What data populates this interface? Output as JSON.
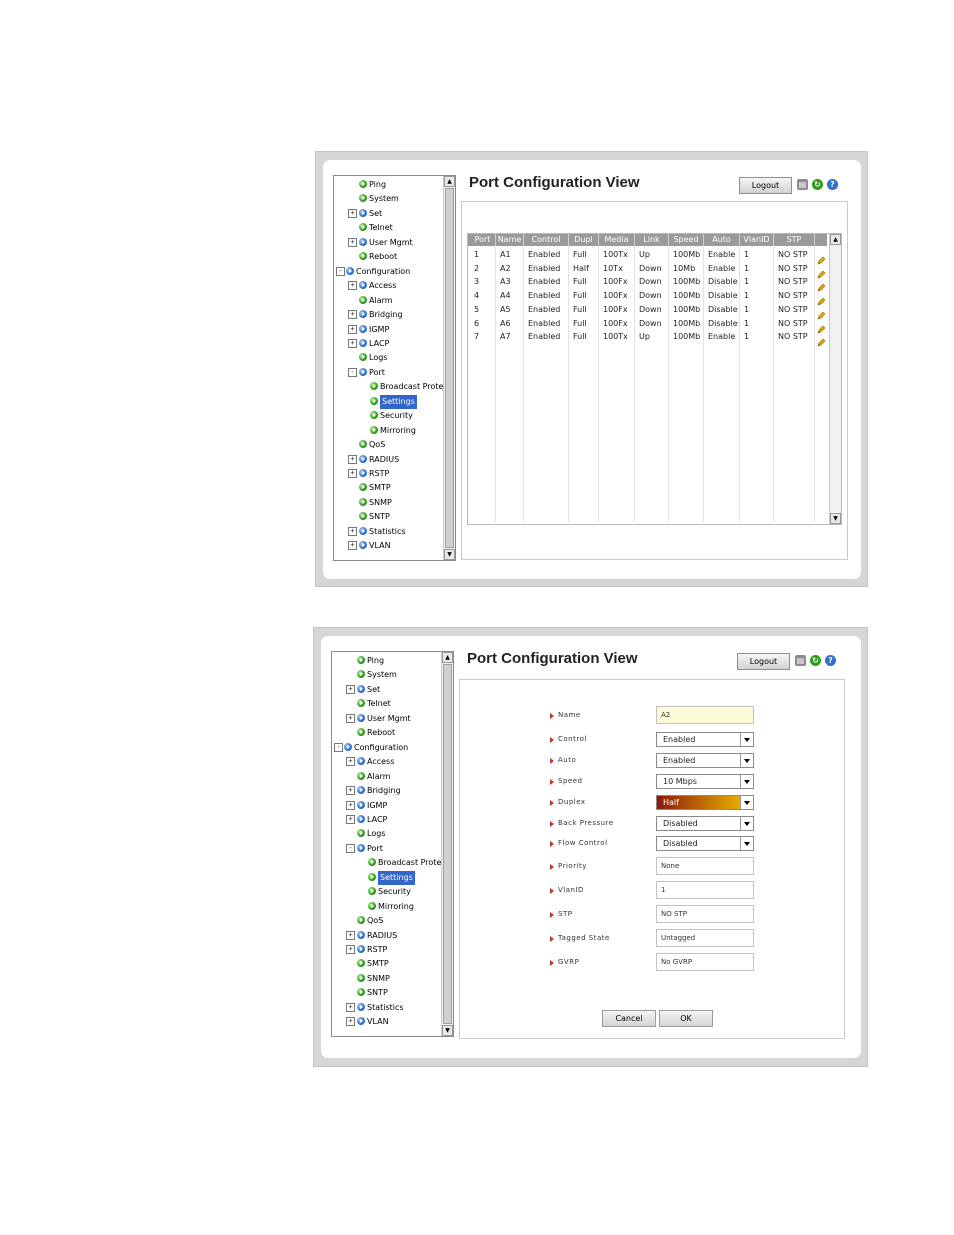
{
  "nav_tree": [
    {
      "label": "Ping",
      "bullet": "green",
      "expander": "",
      "level": 1
    },
    {
      "label": "System",
      "bullet": "green",
      "expander": "",
      "level": 1
    },
    {
      "label": "Set",
      "bullet": "blue",
      "expander": "+",
      "level": 1
    },
    {
      "label": "Telnet",
      "bullet": "green",
      "expander": "",
      "level": 1
    },
    {
      "label": "User Mgmt",
      "bullet": "blue",
      "expander": "+",
      "level": 1
    },
    {
      "label": "Reboot",
      "bullet": "green",
      "expander": "",
      "level": 1
    },
    {
      "label": "Configuration",
      "bullet": "blue",
      "expander": "-",
      "level": 0
    },
    {
      "label": "Access",
      "bullet": "blue",
      "expander": "+",
      "level": 1
    },
    {
      "label": "Alarm",
      "bullet": "green",
      "expander": "",
      "level": 1
    },
    {
      "label": "Bridging",
      "bullet": "blue",
      "expander": "+",
      "level": 1
    },
    {
      "label": "IGMP",
      "bullet": "blue",
      "expander": "+",
      "level": 1
    },
    {
      "label": "LACP",
      "bullet": "blue",
      "expander": "+",
      "level": 1
    },
    {
      "label": "Logs",
      "bullet": "green",
      "expander": "",
      "level": 1
    },
    {
      "label": "Port",
      "bullet": "blue",
      "expander": "-",
      "level": 1
    },
    {
      "label": "Broadcast Protect",
      "bullet": "green",
      "expander": "",
      "level": 2
    },
    {
      "label": "Settings",
      "bullet": "green",
      "expander": "",
      "level": 2,
      "selected": true
    },
    {
      "label": "Security",
      "bullet": "green",
      "expander": "",
      "level": 2
    },
    {
      "label": "Mirroring",
      "bullet": "green",
      "expander": "",
      "level": 2
    },
    {
      "label": "QoS",
      "bullet": "green",
      "expander": "",
      "level": 1
    },
    {
      "label": "RADIUS",
      "bullet": "blue",
      "expander": "+",
      "level": 1
    },
    {
      "label": "RSTP",
      "bullet": "blue",
      "expander": "+",
      "level": 1
    },
    {
      "label": "SMTP",
      "bullet": "green",
      "expander": "",
      "level": 1
    },
    {
      "label": "SNMP",
      "bullet": "green",
      "expander": "",
      "level": 1
    },
    {
      "label": "SNTP",
      "bullet": "green",
      "expander": "",
      "level": 1
    },
    {
      "label": "Statistics",
      "bullet": "blue",
      "expander": "+",
      "level": 1
    },
    {
      "label": "VLAN",
      "bullet": "blue",
      "expander": "+",
      "level": 1
    }
  ],
  "view1": {
    "title": "Port Configuration View",
    "logout": "Logout",
    "columns": [
      "Port",
      "Name",
      "Control",
      "Dupl",
      "Media",
      "Link",
      "Speed",
      "Auto",
      "VlanID",
      "STP"
    ],
    "rows": [
      [
        "1",
        "A1",
        "Enabled",
        "Full",
        "100Tx",
        "Up",
        "100Mb",
        "Enable",
        "1",
        "NO STP"
      ],
      [
        "2",
        "A2",
        "Enabled",
        "Half",
        "10Tx",
        "Down",
        "10Mb",
        "Enable",
        "1",
        "NO STP"
      ],
      [
        "3",
        "A3",
        "Enabled",
        "Full",
        "100Fx",
        "Down",
        "100Mb",
        "Disable",
        "1",
        "NO STP"
      ],
      [
        "4",
        "A4",
        "Enabled",
        "Full",
        "100Fx",
        "Down",
        "100Mb",
        "Disable",
        "1",
        "NO STP"
      ],
      [
        "5",
        "A5",
        "Enabled",
        "Full",
        "100Fx",
        "Down",
        "100Mb",
        "Disable",
        "1",
        "NO STP"
      ],
      [
        "6",
        "A6",
        "Enabled",
        "Full",
        "100Fx",
        "Down",
        "100Mb",
        "Disable",
        "1",
        "NO STP"
      ],
      [
        "7",
        "A7",
        "Enabled",
        "Full",
        "100Tx",
        "Up",
        "100Mb",
        "Enable",
        "1",
        "NO STP"
      ]
    ]
  },
  "view2": {
    "title": "Port Configuration View",
    "logout": "Logout",
    "fields": [
      {
        "label": "Name",
        "type": "input",
        "value": "A2",
        "highlight": true
      },
      {
        "label": "Control",
        "type": "select",
        "value": "Enabled"
      },
      {
        "label": "Auto",
        "type": "select",
        "value": "Enabled"
      },
      {
        "label": "Speed",
        "type": "select",
        "value": "10 Mbps"
      },
      {
        "label": "Duplex",
        "type": "select",
        "value": "Half",
        "hot": true
      },
      {
        "label": "Back Pressure",
        "type": "select",
        "value": "Disabled"
      },
      {
        "label": "Flow Control",
        "type": "select",
        "value": "Disabled"
      },
      {
        "label": "Priority",
        "type": "input",
        "value": "None"
      },
      {
        "label": "VlanID",
        "type": "input",
        "value": "1"
      },
      {
        "label": "STP",
        "type": "input",
        "value": "NO STP"
      },
      {
        "label": "Tagged State",
        "type": "input",
        "value": "Untagged"
      },
      {
        "label": "GVRP",
        "type": "input",
        "value": "No GVRP"
      }
    ],
    "cancel": "Cancel",
    "ok": "OK"
  },
  "colors": {
    "header_gray": "#9a9a9a",
    "selected_blue": "#3465c9",
    "name_bg": "#fdfbd7",
    "duplex_start": "#8b1a0a",
    "duplex_end": "#f5c200"
  }
}
